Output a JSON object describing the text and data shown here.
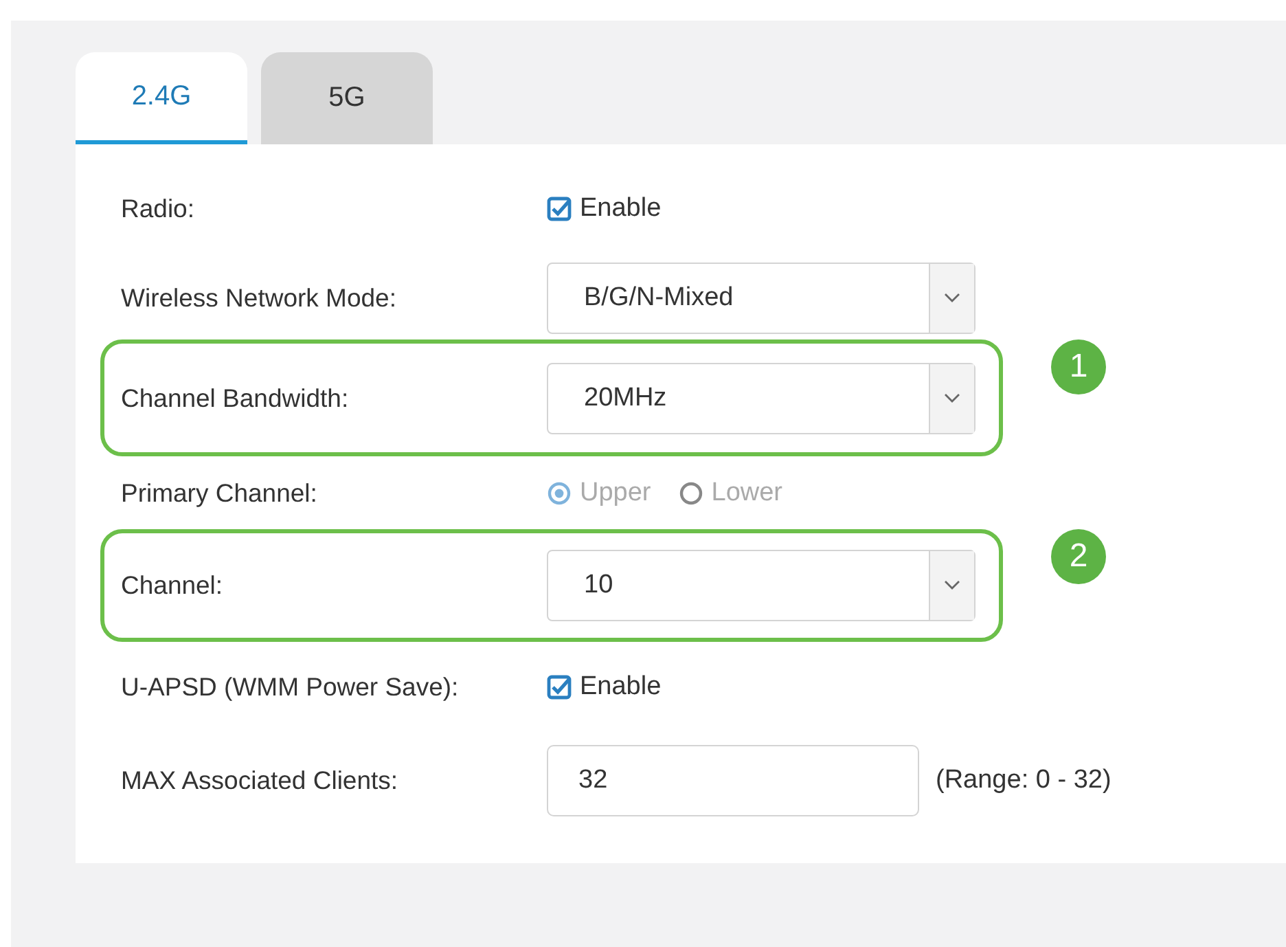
{
  "tabs": [
    {
      "label": "2.4G",
      "selected": true
    },
    {
      "label": "5G",
      "selected": false
    }
  ],
  "rows": [
    {
      "kind": "checkbox",
      "label": "Radio:",
      "option": "Enable",
      "checked": true
    },
    {
      "kind": "select",
      "label": "Wireless Network Mode:",
      "value": "B/G/N-Mixed"
    },
    {
      "kind": "select",
      "label": "Channel Bandwidth:",
      "value": "20MHz",
      "callout": "1"
    },
    {
      "kind": "radio",
      "label": "Primary Channel:",
      "disabled": true,
      "options": [
        {
          "label": "Upper",
          "selected": true
        },
        {
          "label": "Lower",
          "selected": false
        }
      ]
    },
    {
      "kind": "select",
      "label": "Channel:",
      "value": "10",
      "callout": "2"
    },
    {
      "kind": "checkbox",
      "label": "U-APSD (WMM Power Save):",
      "option": "Enable",
      "checked": true
    },
    {
      "kind": "text",
      "label": "MAX Associated Clients:",
      "value": "32",
      "hint": "(Range: 0 - 32)"
    }
  ]
}
